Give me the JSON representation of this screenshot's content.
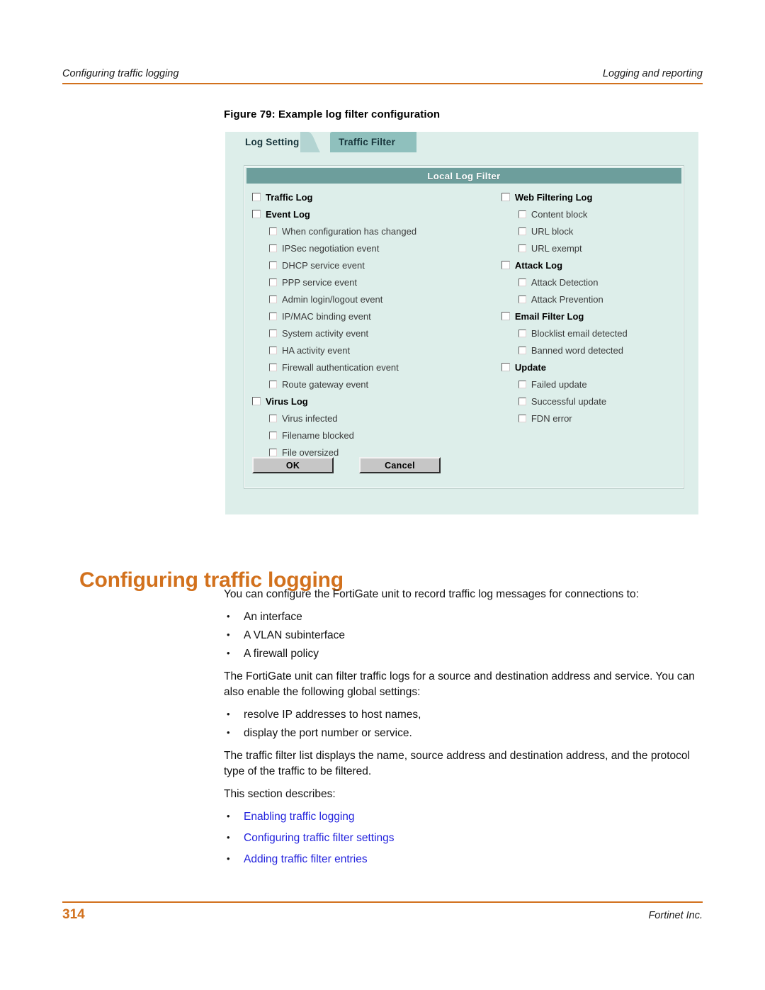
{
  "header": {
    "left": "Configuring traffic logging",
    "right": "Logging and reporting",
    "rule_color": "#d2711d"
  },
  "figure": {
    "caption": "Figure 79: Example log filter configuration",
    "window": {
      "tabs": [
        {
          "label": "Log Setting",
          "active": false
        },
        {
          "label": "Traffic Filter",
          "active": true
        }
      ],
      "panel_title": "Local Log Filter",
      "colors": {
        "window_bg": "#ddeeea",
        "tab_active": "#8fc0bd",
        "panel_title_bar": "#6d9e9c",
        "button_face": "#c6c6c6"
      },
      "left_column": [
        {
          "label": "Traffic Log",
          "level": 0,
          "checked": false
        },
        {
          "label": "Event Log",
          "level": 0,
          "checked": false
        },
        {
          "label": "When configuration has changed",
          "level": 1,
          "checked": false
        },
        {
          "label": "IPSec negotiation event",
          "level": 1,
          "checked": false
        },
        {
          "label": "DHCP service event",
          "level": 1,
          "checked": false
        },
        {
          "label": "PPP service event",
          "level": 1,
          "checked": false
        },
        {
          "label": "Admin login/logout event",
          "level": 1,
          "checked": false
        },
        {
          "label": "IP/MAC binding event",
          "level": 1,
          "checked": false
        },
        {
          "label": "System activity event",
          "level": 1,
          "checked": false
        },
        {
          "label": "HA activity event",
          "level": 1,
          "checked": false
        },
        {
          "label": "Firewall authentication event",
          "level": 1,
          "checked": false
        },
        {
          "label": "Route gateway event",
          "level": 1,
          "checked": false
        },
        {
          "label": "Virus Log",
          "level": 0,
          "checked": false
        },
        {
          "label": "Virus infected",
          "level": 1,
          "checked": false
        },
        {
          "label": "Filename blocked",
          "level": 1,
          "checked": false
        },
        {
          "label": "File oversized",
          "level": 1,
          "checked": false
        }
      ],
      "right_column": [
        {
          "label": "Web Filtering Log",
          "level": 0,
          "checked": false
        },
        {
          "label": "Content block",
          "level": 1,
          "checked": false
        },
        {
          "label": "URL block",
          "level": 1,
          "checked": false
        },
        {
          "label": "URL exempt",
          "level": 1,
          "checked": false
        },
        {
          "label": "Attack Log",
          "level": 0,
          "checked": false
        },
        {
          "label": "Attack Detection",
          "level": 1,
          "checked": false
        },
        {
          "label": "Attack Prevention",
          "level": 1,
          "checked": false
        },
        {
          "label": "Email Filter Log",
          "level": 0,
          "checked": false
        },
        {
          "label": "Blocklist email detected",
          "level": 1,
          "checked": false
        },
        {
          "label": "Banned word detected",
          "level": 1,
          "checked": false
        },
        {
          "label": "Update",
          "level": 0,
          "checked": false
        },
        {
          "label": "Failed update",
          "level": 1,
          "checked": false
        },
        {
          "label": "Successful update",
          "level": 1,
          "checked": false
        },
        {
          "label": "FDN error",
          "level": 1,
          "checked": false
        }
      ],
      "buttons": {
        "ok": "OK",
        "cancel": "Cancel"
      }
    }
  },
  "section": {
    "title": "Configuring traffic logging",
    "title_color": "#d2711d",
    "intro": "You can configure the FortiGate unit to record traffic log messages for connections to:",
    "intro_bullets": [
      "An interface",
      "A VLAN subinterface",
      "A firewall policy"
    ],
    "filter_paragraph": "The FortiGate unit can filter traffic logs for a source and destination address and service. You can also enable the following global settings:",
    "global_bullets": [
      "resolve IP addresses to host names,",
      "display the port number or service."
    ],
    "list_paragraph": "The traffic filter list displays the name, source address and destination address, and the protocol type of the traffic to be filtered.",
    "describes_label": "This section describes:",
    "link_color": "#2222dd",
    "links": [
      "Enabling traffic logging",
      "Configuring traffic filter settings",
      "Adding traffic filter entries"
    ]
  },
  "footer": {
    "page_number": "314",
    "company": "Fortinet Inc."
  }
}
